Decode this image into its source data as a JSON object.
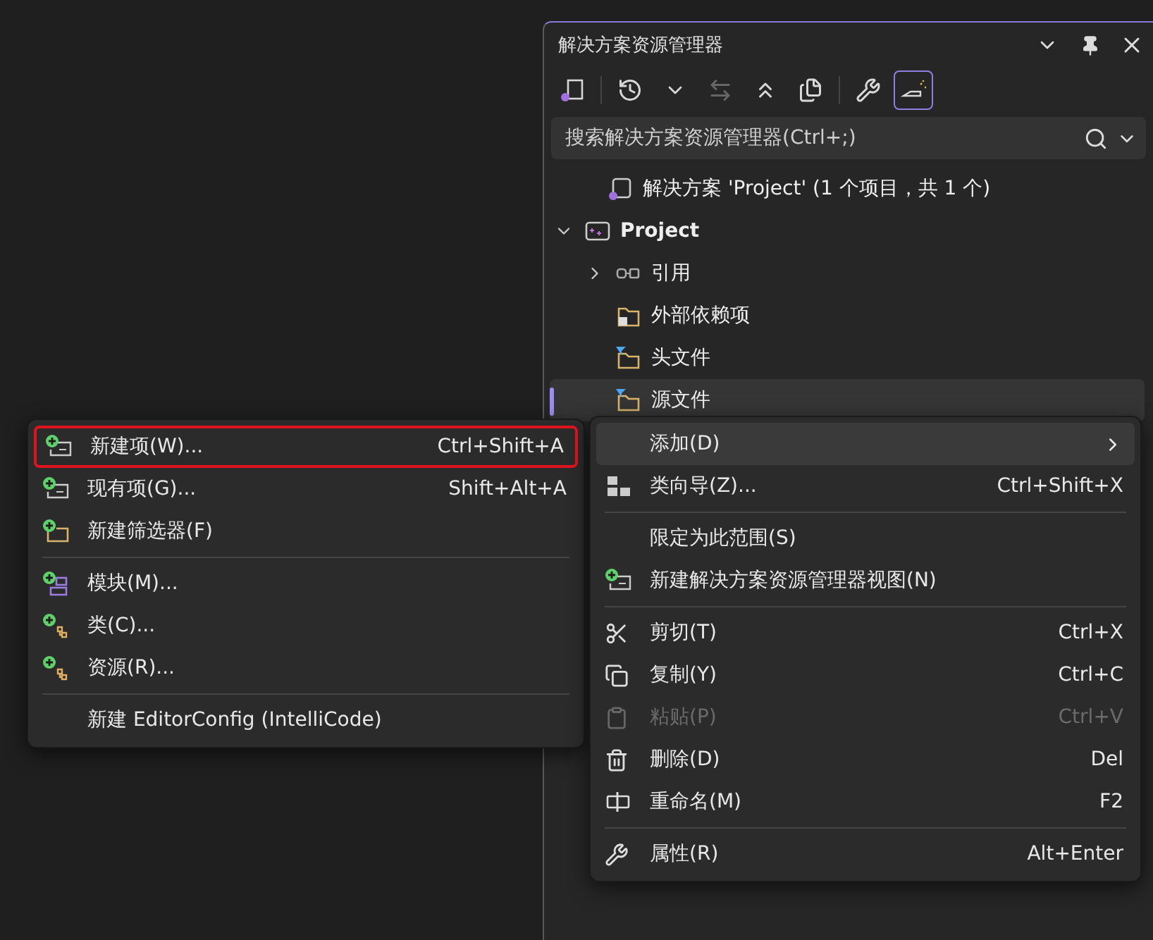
{
  "panel": {
    "title": "解决方案资源管理器",
    "search": {
      "placeholder": "搜索解决方案资源管理器(Ctrl+;)"
    },
    "toolbar": [
      {
        "kind": "button",
        "pressed": false,
        "disabled": false
      },
      {
        "kind": "separator"
      },
      {
        "kind": "button",
        "pressed": false,
        "disabled": false
      },
      {
        "kind": "button",
        "pressed": false,
        "disabled": false
      },
      {
        "kind": "button",
        "pressed": false,
        "disabled": true
      },
      {
        "kind": "button",
        "pressed": false,
        "disabled": false
      },
      {
        "kind": "button",
        "pressed": false,
        "disabled": false
      },
      {
        "kind": "separator"
      },
      {
        "kind": "button",
        "pressed": false,
        "disabled": false
      },
      {
        "kind": "button",
        "pressed": true,
        "disabled": false
      }
    ],
    "tree": [
      {
        "label": "解决方案 'Project' (1 个项目，共 1 个)",
        "bold": false,
        "selected": false,
        "children": [
          {
            "label": "Project",
            "bold": true,
            "selected": false,
            "expanded": true,
            "children": [
              {
                "label": "引用",
                "bold": false,
                "selected": false,
                "expanded": false
              },
              {
                "label": "外部依赖项",
                "bold": false,
                "selected": false
              },
              {
                "label": "头文件",
                "bold": false,
                "selected": false
              },
              {
                "label": "源文件",
                "bold": false,
                "selected": true
              }
            ]
          }
        ]
      }
    ]
  },
  "context_menu": [
    {
      "kind": "item",
      "label": "添加(D)",
      "submenu": true,
      "selected": true,
      "disabled": false
    },
    {
      "kind": "item",
      "label": "类向导(Z)...",
      "shortcut": "Ctrl+Shift+X",
      "submenu": false,
      "selected": false,
      "disabled": false
    },
    {
      "kind": "separator"
    },
    {
      "kind": "item",
      "label": "限定为此范围(S)",
      "submenu": false,
      "selected": false,
      "disabled": false
    },
    {
      "kind": "item",
      "label": "新建解决方案资源管理器视图(N)",
      "submenu": false,
      "selected": false,
      "disabled": false
    },
    {
      "kind": "separator"
    },
    {
      "kind": "item",
      "label": "剪切(T)",
      "shortcut": "Ctrl+X",
      "submenu": false,
      "selected": false,
      "disabled": false
    },
    {
      "kind": "item",
      "label": "复制(Y)",
      "shortcut": "Ctrl+C",
      "submenu": false,
      "selected": false,
      "disabled": false
    },
    {
      "kind": "item",
      "label": "粘贴(P)",
      "shortcut": "Ctrl+V",
      "submenu": false,
      "selected": false,
      "disabled": true
    },
    {
      "kind": "item",
      "label": "删除(D)",
      "shortcut": "Del",
      "submenu": false,
      "selected": false,
      "disabled": false
    },
    {
      "kind": "item",
      "label": "重命名(M)",
      "shortcut": "F2",
      "submenu": false,
      "selected": false,
      "disabled": false
    },
    {
      "kind": "separator"
    },
    {
      "kind": "item",
      "label": "属性(R)",
      "shortcut": "Alt+Enter",
      "submenu": false,
      "selected": false,
      "disabled": false
    }
  ],
  "add_submenu": [
    {
      "kind": "item",
      "label": "新建项(W)...",
      "shortcut": "Ctrl+Shift+A",
      "highlighted": true
    },
    {
      "kind": "item",
      "label": "现有项(G)...",
      "shortcut": "Shift+Alt+A",
      "highlighted": false
    },
    {
      "kind": "item",
      "label": "新建筛选器(F)",
      "highlighted": false
    },
    {
      "kind": "separator"
    },
    {
      "kind": "item",
      "label": "模块(M)...",
      "highlighted": false
    },
    {
      "kind": "item",
      "label": "类(C)...",
      "highlighted": false
    },
    {
      "kind": "item",
      "label": "资源(R)...",
      "highlighted": false
    },
    {
      "kind": "separator"
    },
    {
      "kind": "item",
      "label": "新建 EditorConfig (IntelliCode)",
      "highlighted": false
    }
  ]
}
